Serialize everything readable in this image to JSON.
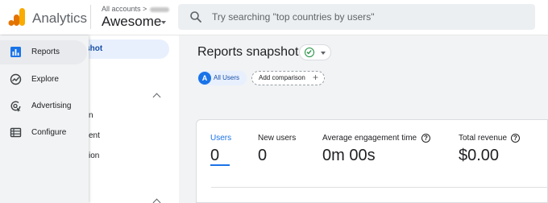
{
  "header": {
    "app_name": "Analytics",
    "account_breadcrumb": "All accounts >",
    "property_name": "Awesome",
    "search_placeholder": "Try searching \"top countries by users\""
  },
  "sidebar_under": {
    "selected_item_fragment": "pshot",
    "peek_items": [
      "n",
      "ent",
      "ion"
    ]
  },
  "nav": {
    "items": [
      {
        "label": "Reports",
        "icon": "bar-chart-icon",
        "active": true
      },
      {
        "label": "Explore",
        "icon": "explore-icon",
        "active": false
      },
      {
        "label": "Advertising",
        "icon": "advertising-icon",
        "active": false
      },
      {
        "label": "Configure",
        "icon": "list-icon",
        "active": false
      }
    ]
  },
  "main": {
    "title": "Reports snapshot",
    "users_chip": {
      "avatar": "A",
      "label": "All Users"
    },
    "add_comparison": "Add comparison",
    "metrics": [
      {
        "label": "Users",
        "value": "0",
        "help": false
      },
      {
        "label": "New users",
        "value": "0",
        "help": false
      },
      {
        "label": "Average engagement time",
        "value": "0m 00s",
        "help": true
      },
      {
        "label": "Total revenue",
        "value": "$0.00",
        "help": true
      }
    ]
  },
  "colors": {
    "accent": "#1a73e8",
    "logo_orange": "#f9ab00",
    "logo_dark_orange": "#e37400",
    "success_green": "#1e8e3e"
  }
}
